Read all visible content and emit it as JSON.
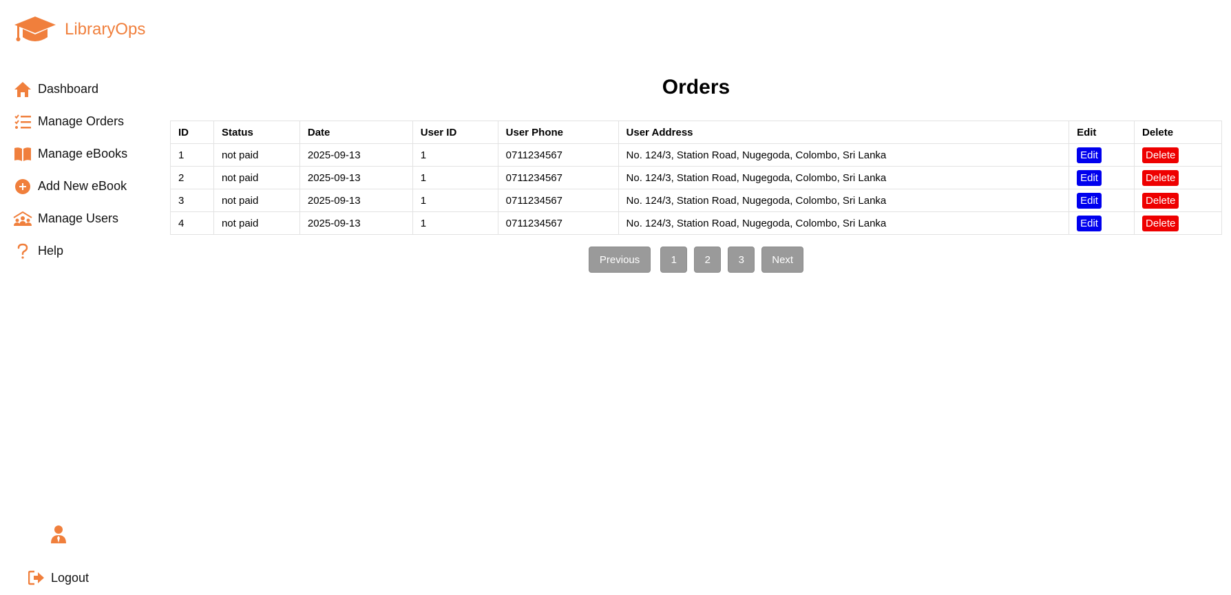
{
  "brand": {
    "name": "LibraryOps",
    "accent_color": "#f07f3c"
  },
  "sidebar": {
    "items": [
      {
        "label": "Dashboard",
        "icon": "home-icon"
      },
      {
        "label": "Manage Orders",
        "icon": "checklist-icon"
      },
      {
        "label": "Manage eBooks",
        "icon": "open-book-icon"
      },
      {
        "label": "Add New eBook",
        "icon": "plus-circle-icon"
      },
      {
        "label": "Manage Users",
        "icon": "users-group-icon"
      },
      {
        "label": "Help",
        "icon": "question-icon"
      }
    ],
    "profile_icon": "user-tie-icon",
    "logout_label": "Logout"
  },
  "main": {
    "title": "Orders",
    "table": {
      "headers": [
        "ID",
        "Status",
        "Date",
        "User ID",
        "User Phone",
        "User Address",
        "Edit",
        "Delete"
      ],
      "rows": [
        {
          "id": "1",
          "status": "not paid",
          "date": "2025-09-13",
          "user_id": "1",
          "phone": "0711234567",
          "address": "No. 124/3, Station Road, Nugegoda, Colombo, Sri Lanka",
          "edit": "Edit",
          "delete": "Delete"
        },
        {
          "id": "2",
          "status": "not paid",
          "date": "2025-09-13",
          "user_id": "1",
          "phone": "0711234567",
          "address": "No. 124/3, Station Road, Nugegoda, Colombo, Sri Lanka",
          "edit": "Edit",
          "delete": "Delete"
        },
        {
          "id": "3",
          "status": "not paid",
          "date": "2025-09-13",
          "user_id": "1",
          "phone": "0711234567",
          "address": "No. 124/3, Station Road, Nugegoda, Colombo, Sri Lanka",
          "edit": "Edit",
          "delete": "Delete"
        },
        {
          "id": "4",
          "status": "not paid",
          "date": "2025-09-13",
          "user_id": "1",
          "phone": "0711234567",
          "address": "No. 124/3, Station Road, Nugegoda, Colombo, Sri Lanka",
          "edit": "Edit",
          "delete": "Delete"
        }
      ]
    },
    "pagination": {
      "previous": "Previous",
      "pages": [
        "1",
        "2",
        "3"
      ],
      "next": "Next"
    }
  },
  "colors": {
    "edit_button": "#0000ee",
    "delete_button": "#ee0000",
    "pagination_button": "#9a9a9a"
  }
}
